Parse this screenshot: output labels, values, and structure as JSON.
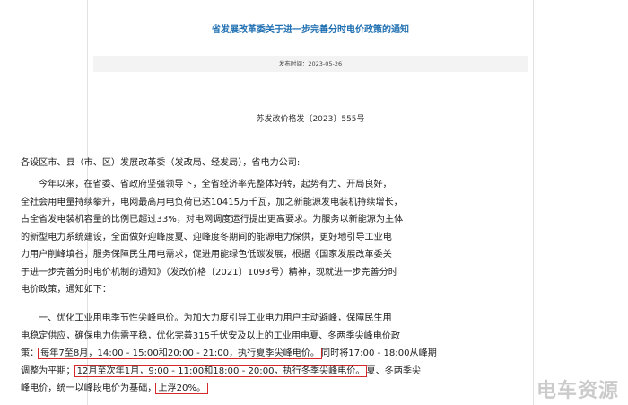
{
  "notice": {
    "title": "省发展改革委关于进一步完善分时电价政策的通知",
    "publish_time": "发布时间：2023-05-26",
    "doc_number": "苏发改价格发〔2023〕555号"
  },
  "body": {
    "salutation": "各设区市、县（市、区）发展改革委（发改局、经发局），省电力公司:",
    "para1_lines": [
      "今年以来，在省委、省政府坚强领导下，全省经济率先整体好转，起势有力、开局良好，",
      "全社会用电量持续攀升，电网最高用电负荷已达10415万千瓦，加之新能源发电装机持续增长，",
      "占全省发电装机容量的比例已超过33%，对电网调度运行提出更高要求。为服务以新能源为主体",
      "的新型电力系统建设，全面做好迎峰度夏、迎峰度冬期间的能源电力保供，更好地引导工业电",
      "力用户削峰填谷，服务保障民生用电需求，促进用能绿色低碳发展，根据《国家发展改革委关",
      "于进一步完善分时电价机制的通知》（发改价格〔2021〕1093号）精神，现就进一步完善分时",
      "电价政策，通知如下："
    ],
    "para2": {
      "line1": "一、优化工业用电季节性尖峰电价。为加大力度引导工业电力用户主动避峰，保障民生用",
      "line2": "电稳定供应，确保电力供需平稳，优化完善315千伏安及以上的工业用电夏、冬两季尖峰电价政",
      "line3_prefix": "策：",
      "line3_highlight": "每年7至8月，14:00 - 15:00和20:00 - 21:00，执行夏季尖峰电价。",
      "line3_suffix": "同时将17:00 - 18:00从峰期",
      "line4_prefix": "调整为平期；",
      "line4_highlight": "12月至次年1月，9:00 - 11:00和18:00 - 20:00，执行冬季尖峰电价。",
      "line4_suffix": "夏、冬两季尖",
      "line5_prefix": "峰电价，统一以峰段电价为基础，",
      "line5_highlight": "上浮20%。"
    }
  },
  "watermark": "电车资源",
  "colors": {
    "title": "#1f6fb2",
    "highlight_border": "#d62a2a",
    "meta_bar": "#f3f3f3"
  }
}
